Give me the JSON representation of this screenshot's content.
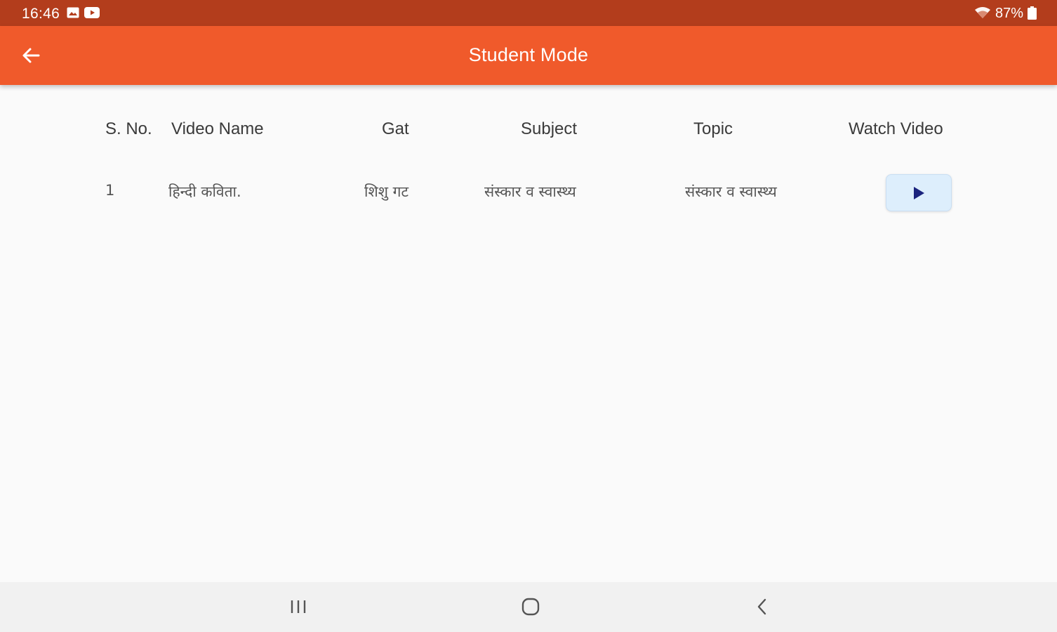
{
  "status_bar": {
    "time": "16:46",
    "battery_text": "87%",
    "icons": [
      "image-icon",
      "youtube-icon",
      "wifi-icon",
      "battery-icon"
    ]
  },
  "app_bar": {
    "title": "Student Mode",
    "back_icon": "arrow-left-icon",
    "background_color": "#f05a2b"
  },
  "table": {
    "columns": [
      "S. No.",
      "Video Name",
      "Gat",
      "Subject",
      "Topic",
      "Watch Video"
    ],
    "rows": [
      {
        "sno": "1",
        "video_name": "हिन्दी कविता.",
        "gat": "शिशु गट",
        "subject": "संस्कार व स्वास्थ्य",
        "topic": "संस्कार व स्वास्थ्य",
        "action_icon": "play-icon"
      }
    ]
  },
  "nav_bar": {
    "icons": [
      "recent-apps-icon",
      "home-icon",
      "back-icon"
    ]
  },
  "colors": {
    "status_bar": "#b33d1c",
    "accent": "#f05a2b",
    "play_button_bg": "#ddeefc",
    "play_icon": "#1a237e"
  }
}
